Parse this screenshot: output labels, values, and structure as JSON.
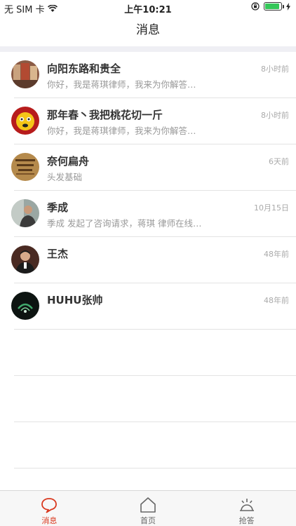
{
  "status_bar": {
    "carrier": "无 SIM 卡",
    "time": "上午10:21",
    "battery_level": 0.9
  },
  "nav": {
    "title": "消息"
  },
  "conversations": [
    {
      "name": "向阳东路和贵全",
      "preview": "你好，我是蒋琪律师，我来为你解答…",
      "time": "8小时前"
    },
    {
      "name": "那年春丶我把桃花切一斤",
      "preview": "你好，我是蒋琪律师，我来为你解答…",
      "time": "8小时前"
    },
    {
      "name": "奈何扁舟",
      "preview": "头发基础",
      "time": "6天前"
    },
    {
      "name": "季成",
      "preview": "季成 发起了咨询请求，蒋琪 律师在线…",
      "time": "10月15日"
    },
    {
      "name": "王杰",
      "preview": "",
      "time": "48年前"
    },
    {
      "name": "HUHU张帅",
      "preview": "",
      "time": "48年前"
    }
  ],
  "tabs": [
    {
      "label": "消息",
      "icon": "chat-bubble-icon",
      "active": true
    },
    {
      "label": "首页",
      "icon": "home-icon",
      "active": false
    },
    {
      "label": "抢答",
      "icon": "bell-icon",
      "active": false
    }
  ],
  "colors": {
    "accent": "#d9381e",
    "battery": "#34c759"
  }
}
